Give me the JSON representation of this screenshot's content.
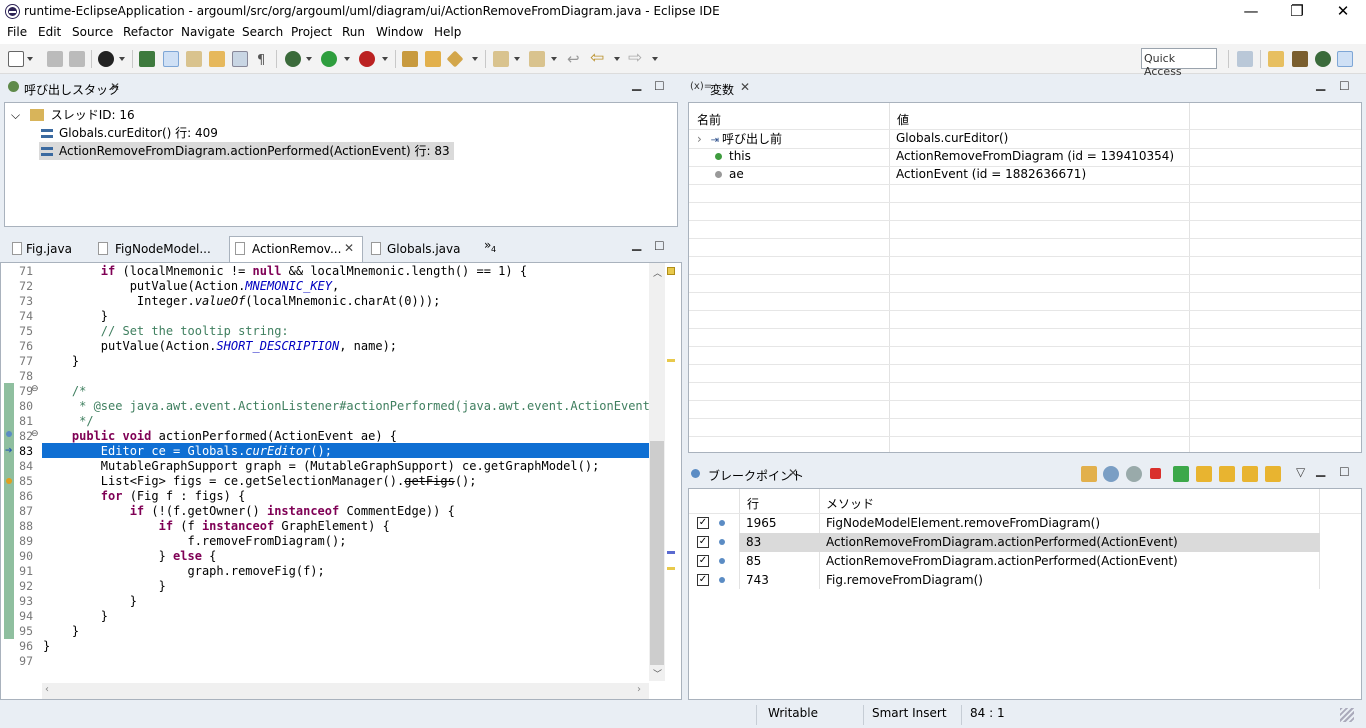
{
  "window": {
    "title": "runtime-EclipseApplication - argouml/src/org/argouml/uml/diagram/ui/ActionRemoveFromDiagram.java - Eclipse IDE",
    "minimize": "—",
    "restore": "❐",
    "close": "✕"
  },
  "menu": [
    "File",
    "Edit",
    "Source",
    "Refactor",
    "Navigate",
    "Search",
    "Project",
    "Run",
    "Window",
    "Help"
  ],
  "quick_access": "Quick Access",
  "callstack": {
    "title": "呼び出しスタック",
    "thread": "スレッドID: 16",
    "frames": [
      "Globals.curEditor() 行: 409",
      "ActionRemoveFromDiagram.actionPerformed(ActionEvent) 行: 83"
    ]
  },
  "editor": {
    "tabs": [
      "Fig.java",
      "FigNodeModel...",
      "ActionRemov...",
      "Globals.java"
    ],
    "overflow": "»",
    "overflow_count": "4",
    "lines": [
      {
        "n": "71"
      },
      {
        "n": "72"
      },
      {
        "n": "73"
      },
      {
        "n": "74"
      },
      {
        "n": "75"
      },
      {
        "n": "76"
      },
      {
        "n": "77"
      },
      {
        "n": "78"
      },
      {
        "n": "79"
      },
      {
        "n": "80"
      },
      {
        "n": "81"
      },
      {
        "n": "82"
      },
      {
        "n": "83"
      },
      {
        "n": "84"
      },
      {
        "n": "85"
      },
      {
        "n": "86"
      },
      {
        "n": "87"
      },
      {
        "n": "88"
      },
      {
        "n": "89"
      },
      {
        "n": "90"
      },
      {
        "n": "91"
      },
      {
        "n": "92"
      },
      {
        "n": "93"
      },
      {
        "n": "94"
      },
      {
        "n": "95"
      },
      {
        "n": "96"
      },
      {
        "n": "97"
      }
    ]
  },
  "variables": {
    "title": "変数",
    "title_prefix": "(x)=",
    "col_name": "名前",
    "col_value": "値",
    "rows": [
      {
        "name": "呼び出し前",
        "value": "Globals.curEditor()"
      },
      {
        "name": "this",
        "value": "ActionRemoveFromDiagram  (id = 139410354)"
      },
      {
        "name": "ae",
        "value": "ActionEvent  (id = 1882636671)"
      }
    ]
  },
  "breakpoints": {
    "title": "ブレークポイント",
    "col_line": "行",
    "col_method": "メソッド",
    "rows": [
      {
        "line": "1965",
        "method": "FigNodeModelElement.removeFromDiagram()"
      },
      {
        "line": "83",
        "method": "ActionRemoveFromDiagram.actionPerformed(ActionEvent)"
      },
      {
        "line": "85",
        "method": "ActionRemoveFromDiagram.actionPerformed(ActionEvent)"
      },
      {
        "line": "743",
        "method": "Fig.removeFromDiagram()"
      }
    ]
  },
  "status": {
    "writable": "Writable",
    "insert": "Smart Insert",
    "position": "84 : 1"
  },
  "colors": {
    "selection": "#0f6fd3",
    "keyword": "#7f0055",
    "field": "#0000c0",
    "comment": "#3f7f5f",
    "breakpoint": "#5b8cc4"
  }
}
